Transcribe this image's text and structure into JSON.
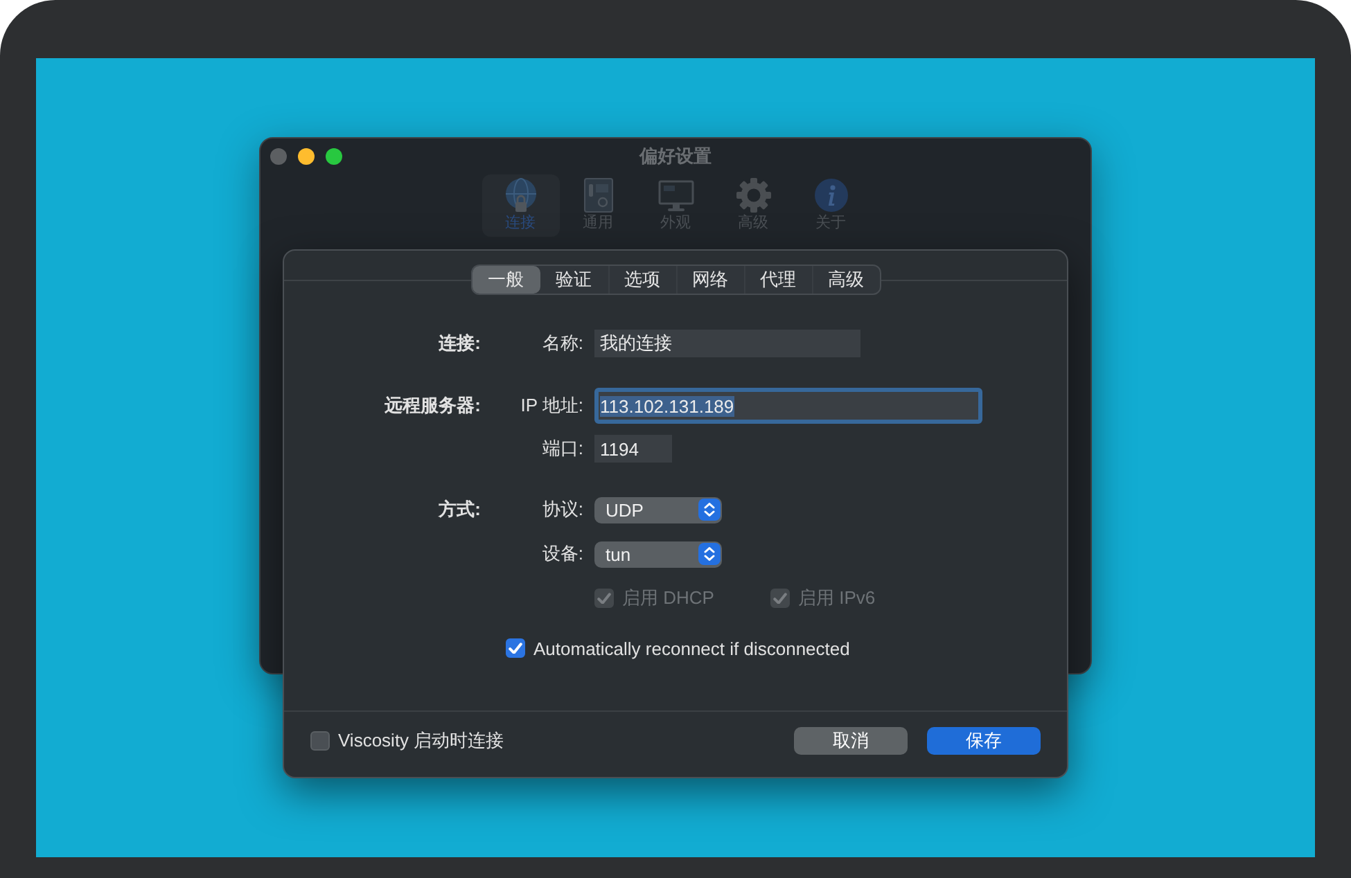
{
  "window": {
    "title": "偏好设置",
    "traffic_lights": [
      {
        "kind": "close",
        "disabled": true
      },
      {
        "kind": "minimize",
        "disabled": false
      },
      {
        "kind": "zoom",
        "disabled": false
      }
    ]
  },
  "toolbar": {
    "items": [
      {
        "kind": "connection",
        "label": "连接",
        "selected": true
      },
      {
        "kind": "general",
        "label": "通用",
        "selected": false
      },
      {
        "kind": "appearance",
        "label": "外观",
        "selected": false
      },
      {
        "kind": "advanced",
        "label": "高级",
        "selected": false
      },
      {
        "kind": "about",
        "label": "关于",
        "selected": false
      }
    ]
  },
  "sheet": {
    "tabs": [
      {
        "label": "一般",
        "selected": true
      },
      {
        "label": "验证",
        "selected": false
      },
      {
        "label": "选项",
        "selected": false
      },
      {
        "label": "网络",
        "selected": false
      },
      {
        "label": "代理",
        "selected": false
      },
      {
        "label": "高级",
        "selected": false
      }
    ],
    "sections": [
      {
        "label": "连接:",
        "rows": [
          {
            "kind": "text",
            "label": "名称:",
            "value": "我的连接",
            "focused": false
          }
        ]
      },
      {
        "label": "远程服务器:",
        "rows": [
          {
            "kind": "text",
            "label": "IP 地址:",
            "value": "113.102.131.189",
            "focused": true
          },
          {
            "kind": "text",
            "label": "端口:",
            "value": "1194",
            "focused": false
          }
        ]
      },
      {
        "label": "方式:",
        "rows": [
          {
            "kind": "popup",
            "label": "协议:",
            "value": "UDP"
          },
          {
            "kind": "popup",
            "label": "设备:",
            "value": "tun"
          },
          {
            "kind": "checks",
            "items": [
              {
                "label": "启用 DHCP",
                "checked": true,
                "disabled": true
              },
              {
                "label": "启用 IPv6",
                "checked": true,
                "disabled": true
              }
            ]
          }
        ]
      }
    ],
    "reconnect": {
      "label": "Automatically reconnect if disconnected",
      "checked": true
    },
    "footer": {
      "launch_option": {
        "label": "Viscosity 启动时连接",
        "checked": false
      },
      "buttons": [
        {
          "kind": "secondary",
          "label": "取消"
        },
        {
          "kind": "primary",
          "label": "保存"
        }
      ]
    }
  }
}
